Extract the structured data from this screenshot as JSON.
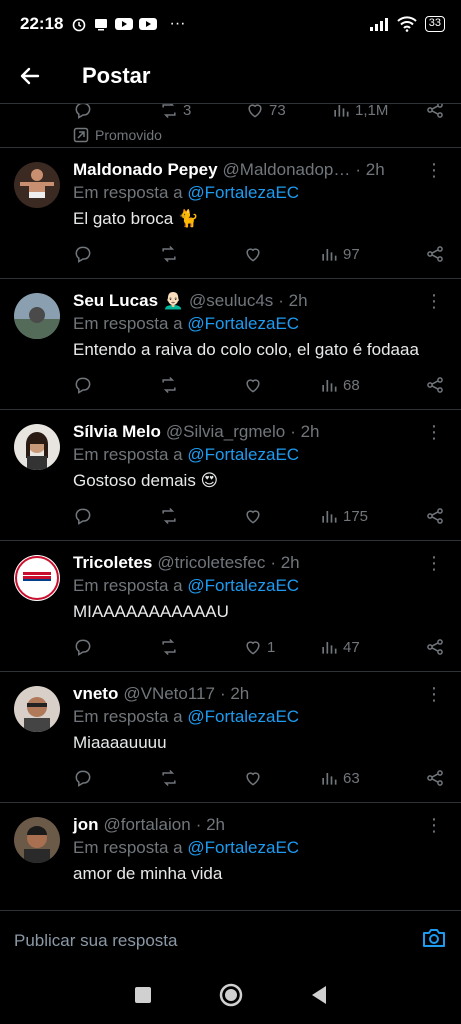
{
  "status": {
    "time": "22:18",
    "battery": "33"
  },
  "header": {
    "title": "Postar"
  },
  "prev_post": {
    "retweets": "3",
    "likes": "73",
    "views": "1,1M"
  },
  "promoted_label": "Promovido",
  "posts": [
    {
      "name": "Maldonado Pepey",
      "handle": "@Maldonadop…",
      "time": "· 2h",
      "reply_prefix": "Em resposta a",
      "reply_to": "@FortalezaEC",
      "text": "El gato broca 🐈",
      "likes": "",
      "views": "97"
    },
    {
      "name": "Seu Lucas 👨🏻‍🦲",
      "handle": "@seuluc4s",
      "time": "· 2h",
      "reply_prefix": "Em resposta a",
      "reply_to": "@FortalezaEC",
      "text": "Entendo a raiva do colo colo, el gato é fodaaa",
      "likes": "",
      "views": "68"
    },
    {
      "name": "Sílvia Melo",
      "handle": "@Silvia_rgmelo",
      "time": "· 2h",
      "reply_prefix": "Em resposta a",
      "reply_to": "@FortalezaEC",
      "text": "Gostoso demais 😍",
      "likes": "",
      "views": "175"
    },
    {
      "name": "Tricoletes",
      "handle": "@tricoletesfec",
      "time": "· 2h",
      "reply_prefix": "Em resposta a",
      "reply_to": "@FortalezaEC",
      "text": "MIAAAAAAAAAAAU",
      "likes": "1",
      "views": "47"
    },
    {
      "name": "vneto",
      "handle": "@VNeto117",
      "time": "· 2h",
      "reply_prefix": "Em resposta a",
      "reply_to": "@FortalezaEC",
      "text": "Miaaaauuuu",
      "likes": "",
      "views": "63"
    },
    {
      "name": "jon",
      "handle": "@fortalaion",
      "time": "· 2h",
      "reply_prefix": "Em resposta a",
      "reply_to": "@FortalezaEC",
      "text": "amor de minha vida",
      "likes": "",
      "views": ""
    }
  ],
  "composer": {
    "placeholder": "Publicar sua resposta"
  },
  "colors": {
    "accent": "#1d9bf0",
    "muted": "#71767b",
    "border": "#2f3336"
  }
}
